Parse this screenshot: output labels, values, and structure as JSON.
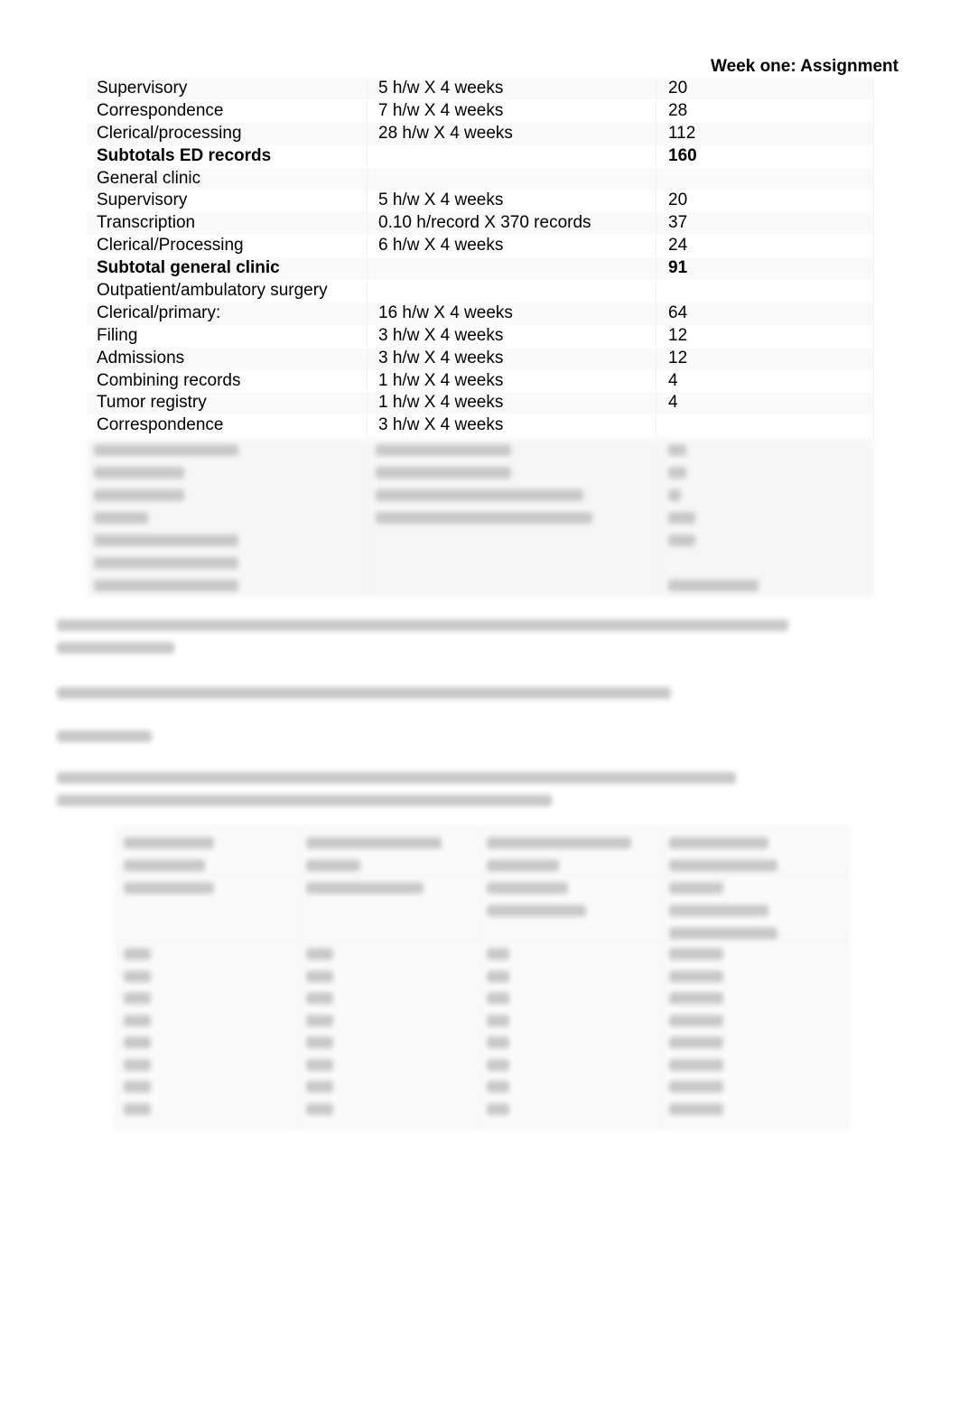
{
  "header": {
    "title": "Week one: Assignment"
  },
  "table": {
    "rows": [
      {
        "activity": "Supervisory",
        "calc": "5 h/w X 4 weeks",
        "hours": "20",
        "bold": false
      },
      {
        "activity": "Correspondence",
        "calc": "7 h/w X 4 weeks",
        "hours": "28",
        "bold": false
      },
      {
        "activity": "Clerical/processing",
        "calc": "28 h/w X 4 weeks",
        "hours": "112",
        "bold": false
      },
      {
        "activity": "Subtotals ED records",
        "calc": "",
        "hours": "160",
        "bold": true
      },
      {
        "activity": "General clinic",
        "calc": "",
        "hours": "",
        "bold": false
      },
      {
        "activity": "Supervisory",
        "calc": "5 h/w X 4 weeks",
        "hours": "20",
        "bold": false
      },
      {
        "activity": "Transcription",
        "calc": "0.10 h/record X 370 records",
        "hours": "37",
        "bold": false
      },
      {
        "activity": "Clerical/Processing",
        "calc": "6 h/w X 4 weeks",
        "hours": "24",
        "bold": false
      },
      {
        "activity": "Subtotal general clinic",
        "calc": "",
        "hours": "91",
        "bold": true
      },
      {
        "activity": "Outpatient/ambulatory surgery",
        "calc": "",
        "hours": "",
        "bold": false
      },
      {
        "activity": "Clerical/primary:",
        "calc": "16 h/w X 4 weeks",
        "hours": "64",
        "bold": false
      },
      {
        "activity": "Filing",
        "calc": "3 h/w X 4 weeks",
        "hours": "12",
        "bold": false
      },
      {
        "activity": "Admissions",
        "calc": "3 h/w X 4 weeks",
        "hours": "12",
        "bold": false
      },
      {
        "activity": "Combining records",
        "calc": "1 h/w X 4 weeks",
        "hours": "4",
        "bold": false
      },
      {
        "activity": "Tumor registry",
        "calc": "1 h/w X 4 weeks",
        "hours": "4",
        "bold": false
      },
      {
        "activity": "Correspondence",
        "calc": "3 h/w X 4 weeks",
        "hours": "",
        "bold": false
      }
    ]
  }
}
